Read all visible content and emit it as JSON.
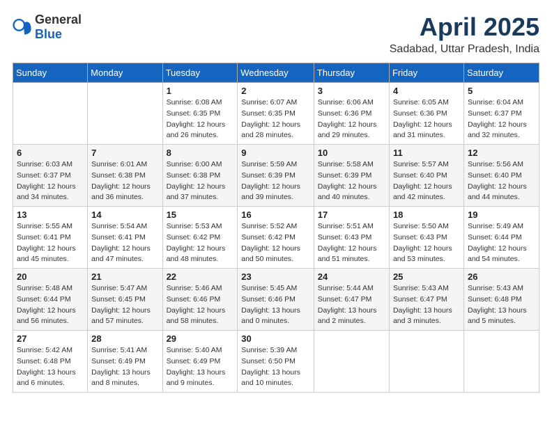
{
  "header": {
    "logo_general": "General",
    "logo_blue": "Blue",
    "month": "April 2025",
    "location": "Sadabad, Uttar Pradesh, India"
  },
  "columns": [
    "Sunday",
    "Monday",
    "Tuesday",
    "Wednesday",
    "Thursday",
    "Friday",
    "Saturday"
  ],
  "weeks": [
    {
      "days": [
        {
          "num": "",
          "detail": ""
        },
        {
          "num": "",
          "detail": ""
        },
        {
          "num": "1",
          "detail": "Sunrise: 6:08 AM\nSunset: 6:35 PM\nDaylight: 12 hours\nand 26 minutes."
        },
        {
          "num": "2",
          "detail": "Sunrise: 6:07 AM\nSunset: 6:35 PM\nDaylight: 12 hours\nand 28 minutes."
        },
        {
          "num": "3",
          "detail": "Sunrise: 6:06 AM\nSunset: 6:36 PM\nDaylight: 12 hours\nand 29 minutes."
        },
        {
          "num": "4",
          "detail": "Sunrise: 6:05 AM\nSunset: 6:36 PM\nDaylight: 12 hours\nand 31 minutes."
        },
        {
          "num": "5",
          "detail": "Sunrise: 6:04 AM\nSunset: 6:37 PM\nDaylight: 12 hours\nand 32 minutes."
        }
      ]
    },
    {
      "days": [
        {
          "num": "6",
          "detail": "Sunrise: 6:03 AM\nSunset: 6:37 PM\nDaylight: 12 hours\nand 34 minutes."
        },
        {
          "num": "7",
          "detail": "Sunrise: 6:01 AM\nSunset: 6:38 PM\nDaylight: 12 hours\nand 36 minutes."
        },
        {
          "num": "8",
          "detail": "Sunrise: 6:00 AM\nSunset: 6:38 PM\nDaylight: 12 hours\nand 37 minutes."
        },
        {
          "num": "9",
          "detail": "Sunrise: 5:59 AM\nSunset: 6:39 PM\nDaylight: 12 hours\nand 39 minutes."
        },
        {
          "num": "10",
          "detail": "Sunrise: 5:58 AM\nSunset: 6:39 PM\nDaylight: 12 hours\nand 40 minutes."
        },
        {
          "num": "11",
          "detail": "Sunrise: 5:57 AM\nSunset: 6:40 PM\nDaylight: 12 hours\nand 42 minutes."
        },
        {
          "num": "12",
          "detail": "Sunrise: 5:56 AM\nSunset: 6:40 PM\nDaylight: 12 hours\nand 44 minutes."
        }
      ]
    },
    {
      "days": [
        {
          "num": "13",
          "detail": "Sunrise: 5:55 AM\nSunset: 6:41 PM\nDaylight: 12 hours\nand 45 minutes."
        },
        {
          "num": "14",
          "detail": "Sunrise: 5:54 AM\nSunset: 6:41 PM\nDaylight: 12 hours\nand 47 minutes."
        },
        {
          "num": "15",
          "detail": "Sunrise: 5:53 AM\nSunset: 6:42 PM\nDaylight: 12 hours\nand 48 minutes."
        },
        {
          "num": "16",
          "detail": "Sunrise: 5:52 AM\nSunset: 6:42 PM\nDaylight: 12 hours\nand 50 minutes."
        },
        {
          "num": "17",
          "detail": "Sunrise: 5:51 AM\nSunset: 6:43 PM\nDaylight: 12 hours\nand 51 minutes."
        },
        {
          "num": "18",
          "detail": "Sunrise: 5:50 AM\nSunset: 6:43 PM\nDaylight: 12 hours\nand 53 minutes."
        },
        {
          "num": "19",
          "detail": "Sunrise: 5:49 AM\nSunset: 6:44 PM\nDaylight: 12 hours\nand 54 minutes."
        }
      ]
    },
    {
      "days": [
        {
          "num": "20",
          "detail": "Sunrise: 5:48 AM\nSunset: 6:44 PM\nDaylight: 12 hours\nand 56 minutes."
        },
        {
          "num": "21",
          "detail": "Sunrise: 5:47 AM\nSunset: 6:45 PM\nDaylight: 12 hours\nand 57 minutes."
        },
        {
          "num": "22",
          "detail": "Sunrise: 5:46 AM\nSunset: 6:46 PM\nDaylight: 12 hours\nand 58 minutes."
        },
        {
          "num": "23",
          "detail": "Sunrise: 5:45 AM\nSunset: 6:46 PM\nDaylight: 13 hours\nand 0 minutes."
        },
        {
          "num": "24",
          "detail": "Sunrise: 5:44 AM\nSunset: 6:47 PM\nDaylight: 13 hours\nand 2 minutes."
        },
        {
          "num": "25",
          "detail": "Sunrise: 5:43 AM\nSunset: 6:47 PM\nDaylight: 13 hours\nand 3 minutes."
        },
        {
          "num": "26",
          "detail": "Sunrise: 5:43 AM\nSunset: 6:48 PM\nDaylight: 13 hours\nand 5 minutes."
        }
      ]
    },
    {
      "days": [
        {
          "num": "27",
          "detail": "Sunrise: 5:42 AM\nSunset: 6:48 PM\nDaylight: 13 hours\nand 6 minutes."
        },
        {
          "num": "28",
          "detail": "Sunrise: 5:41 AM\nSunset: 6:49 PM\nDaylight: 13 hours\nand 8 minutes."
        },
        {
          "num": "29",
          "detail": "Sunrise: 5:40 AM\nSunset: 6:49 PM\nDaylight: 13 hours\nand 9 minutes."
        },
        {
          "num": "30",
          "detail": "Sunrise: 5:39 AM\nSunset: 6:50 PM\nDaylight: 13 hours\nand 10 minutes."
        },
        {
          "num": "",
          "detail": ""
        },
        {
          "num": "",
          "detail": ""
        },
        {
          "num": "",
          "detail": ""
        }
      ]
    }
  ]
}
